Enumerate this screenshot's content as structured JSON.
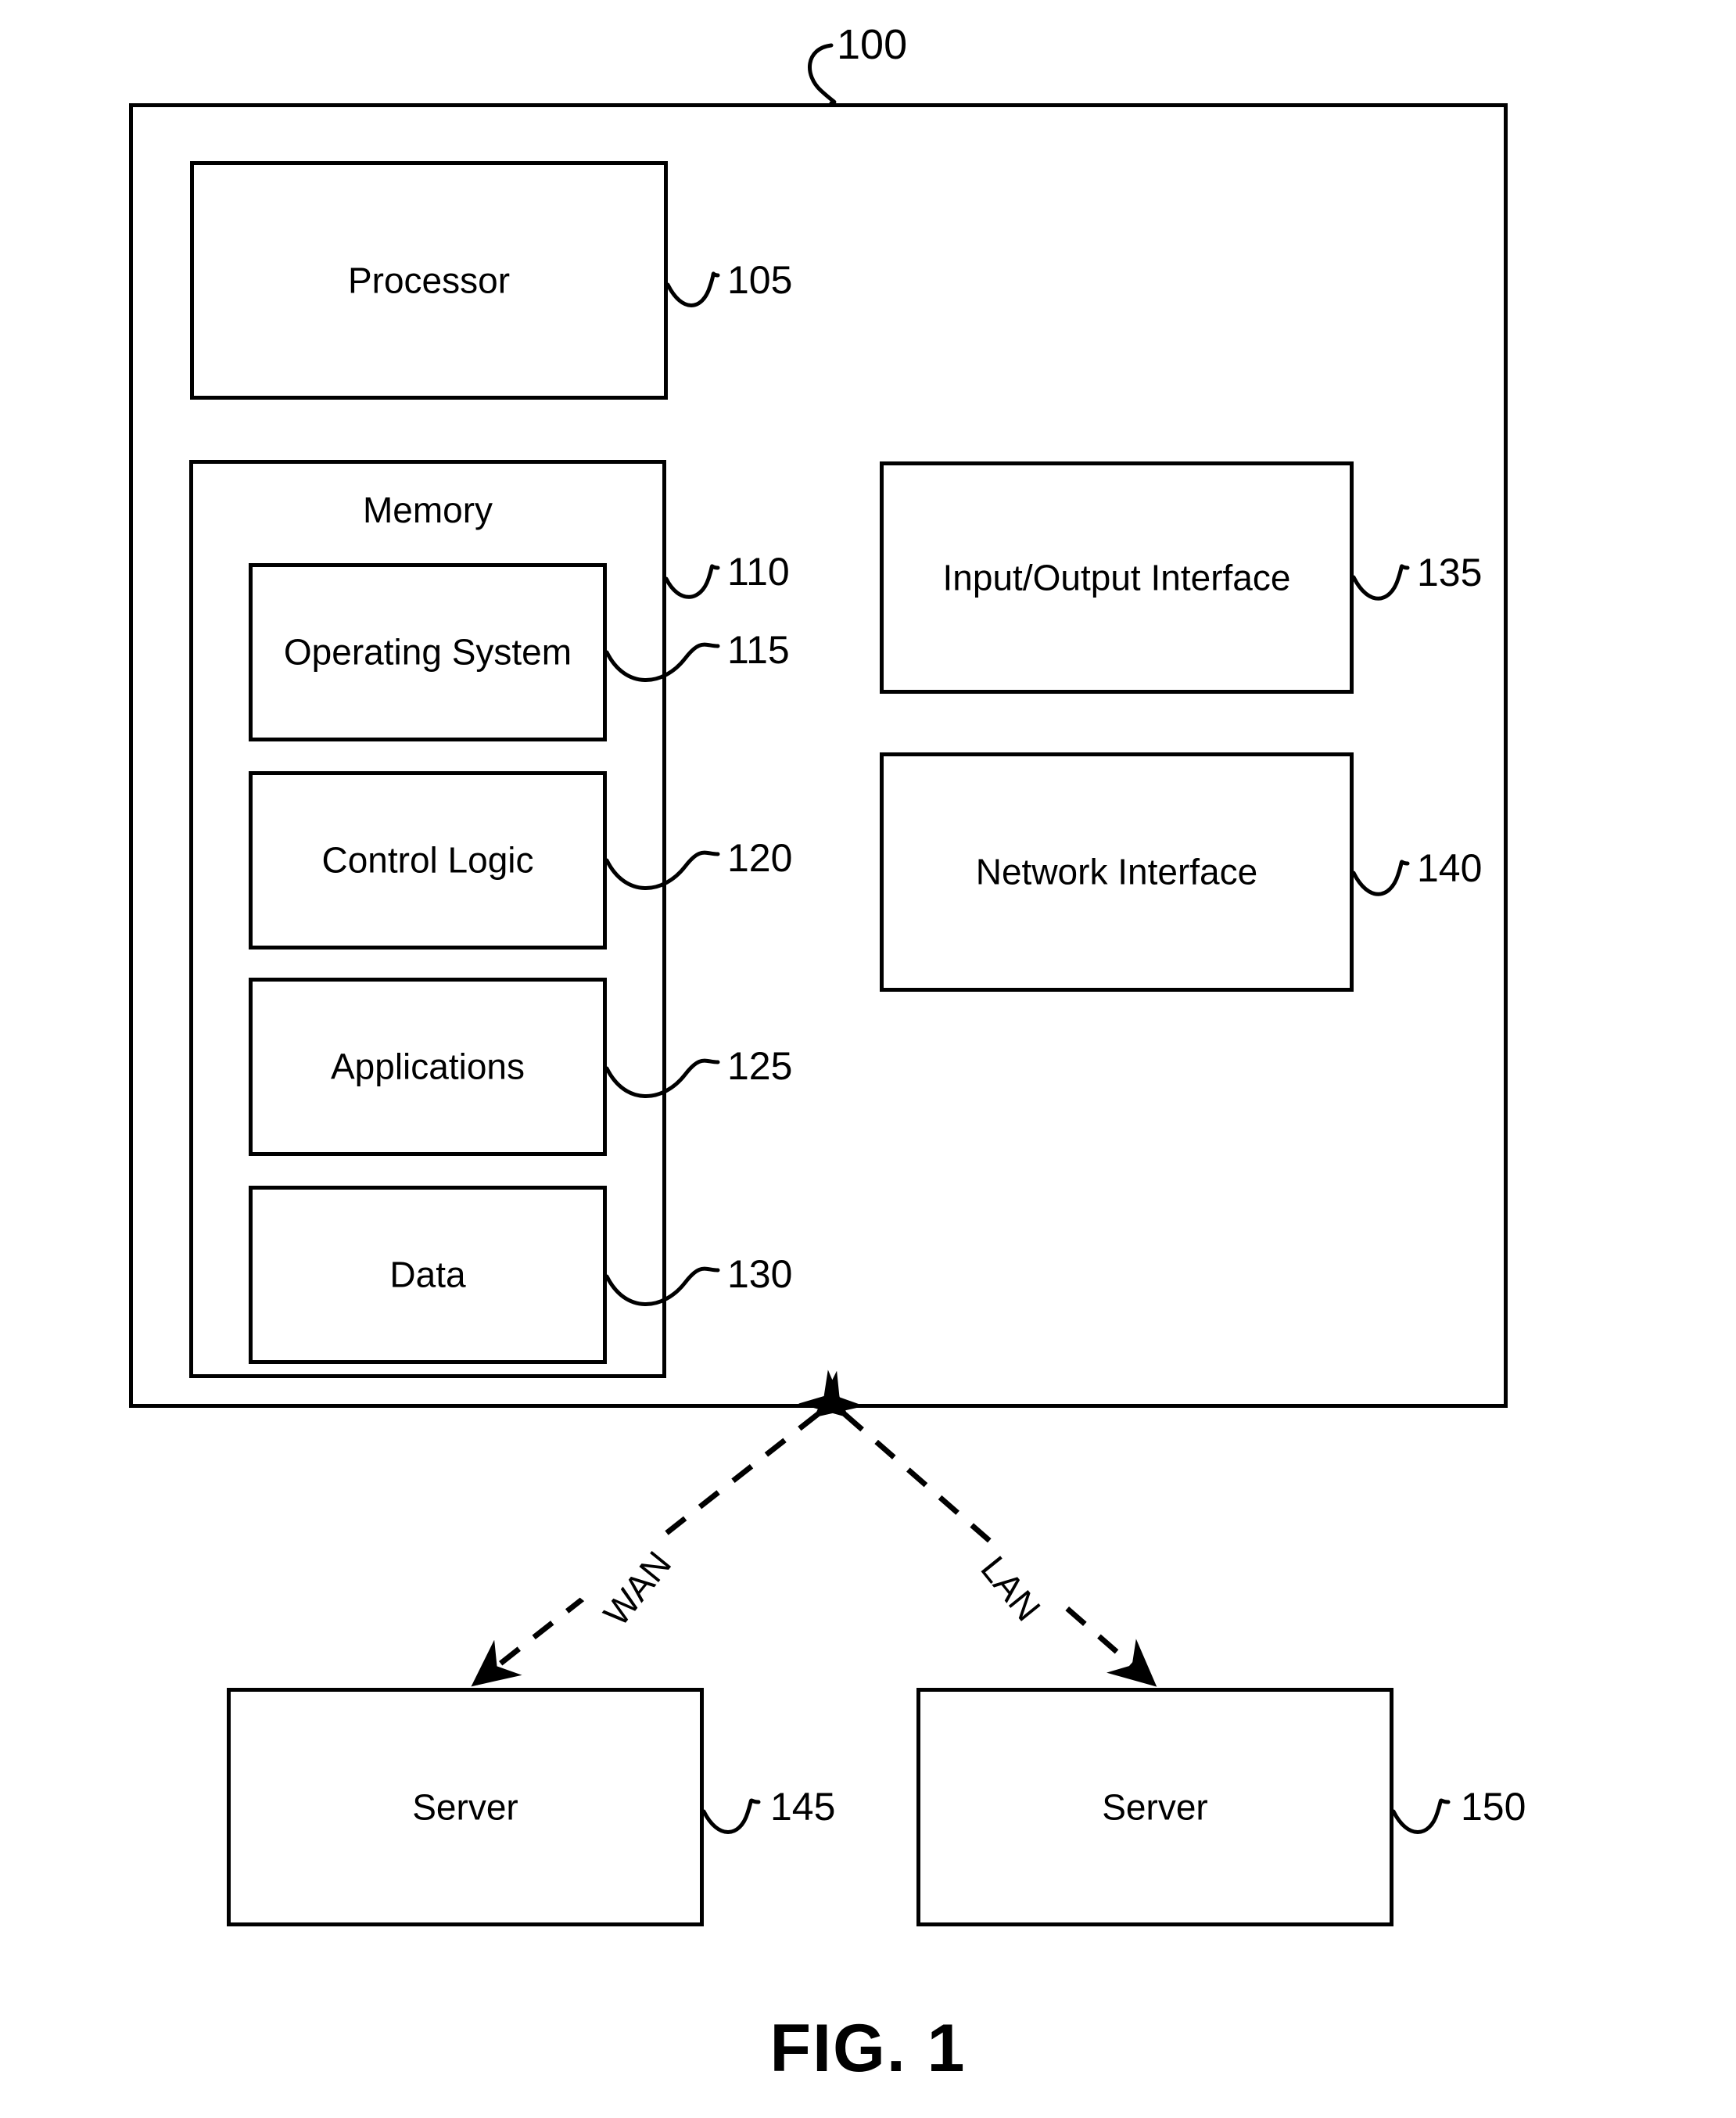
{
  "figure": {
    "caption": "FIG. 1",
    "system_ref": "100"
  },
  "system": {
    "components": [
      {
        "id": "processor",
        "label": "Processor",
        "ref": "105"
      },
      {
        "id": "memory",
        "label": "Memory",
        "ref": "110"
      },
      {
        "id": "operating-system",
        "label": "Operating System",
        "ref": "115"
      },
      {
        "id": "control-logic",
        "label": "Control Logic",
        "ref": "120"
      },
      {
        "id": "applications",
        "label": "Applications",
        "ref": "125"
      },
      {
        "id": "data",
        "label": "Data",
        "ref": "130"
      },
      {
        "id": "io-interface",
        "label": "Input/Output Interface",
        "ref": "135"
      },
      {
        "id": "network-interface",
        "label": "Network Interface",
        "ref": "140"
      }
    ]
  },
  "network": {
    "links": [
      {
        "id": "wan-link",
        "label": "WAN"
      },
      {
        "id": "lan-link",
        "label": "LAN"
      }
    ],
    "nodes": [
      {
        "id": "server-left",
        "label": "Server",
        "ref": "145"
      },
      {
        "id": "server-right",
        "label": "Server",
        "ref": "150"
      }
    ]
  },
  "style": {
    "line_color": "#000000",
    "background": "#ffffff"
  }
}
